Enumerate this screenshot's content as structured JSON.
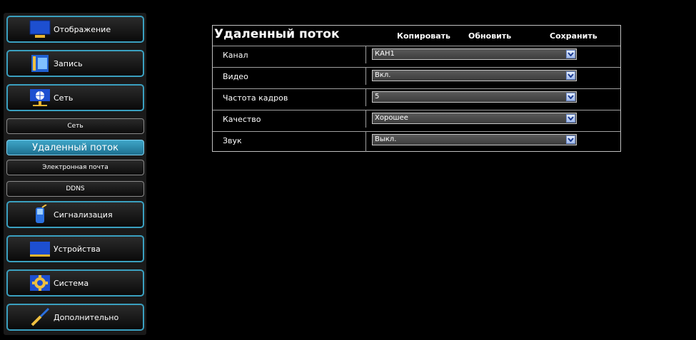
{
  "sidebar": {
    "display": "Отображение",
    "record": "Запись",
    "network": "Сеть",
    "sub_network": "Сеть",
    "sub_remote_stream": "Удаленный поток",
    "sub_email": "Электронная почта",
    "sub_ddns": "DDNS",
    "alarm": "Сигнализация",
    "devices": "Устройства",
    "system": "Система",
    "advanced": "Дополнительно"
  },
  "panel": {
    "title": "Удаленный поток",
    "copy": "Копировать",
    "refresh": "Обновить",
    "save": "Сохранить",
    "rows": [
      {
        "label": "Канал",
        "value": "КАН1"
      },
      {
        "label": "Видео",
        "value": "Вкл."
      },
      {
        "label": "Частота кадров",
        "value": "5"
      },
      {
        "label": "Качество",
        "value": "Хорошее"
      },
      {
        "label": "Звук",
        "value": "Выкл."
      }
    ]
  },
  "colors": {
    "accent": "#3aa0c0",
    "active_sub": "#2f8db0"
  }
}
